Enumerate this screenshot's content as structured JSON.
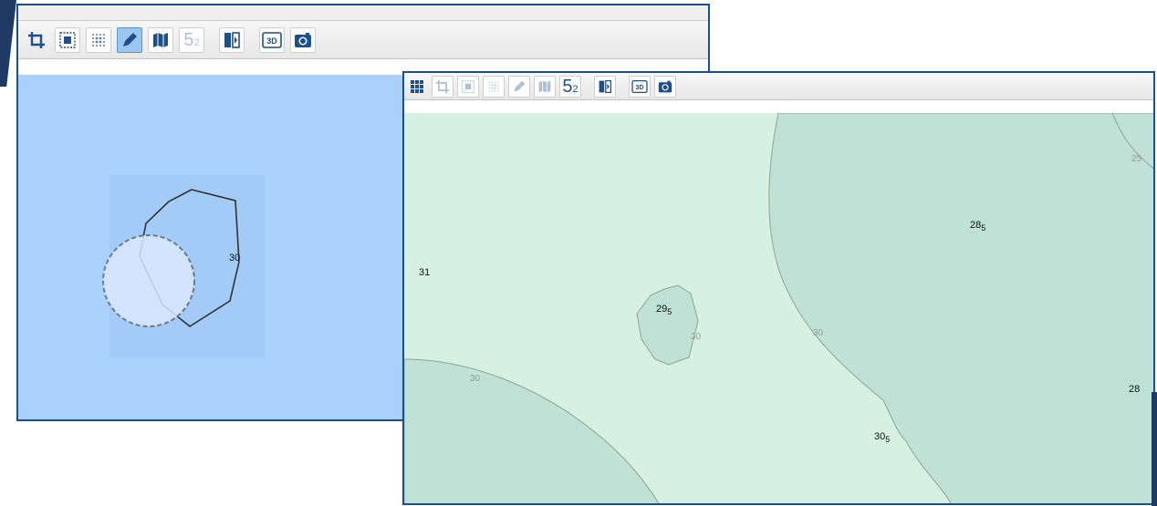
{
  "back_panel": {
    "contour_label": "30",
    "toolbar_icons": [
      "crop-icon",
      "select-frame-icon",
      "dot-grid-icon",
      "pencil-icon",
      "map-icon",
      "subscript-5-2-icon",
      "split-compare-icon",
      "3d-icon",
      "camera-icon"
    ],
    "active_tool": "pencil",
    "subscript_label": {
      "main": "5",
      "sub": "2"
    },
    "three_d_label": "3D"
  },
  "front_panel": {
    "toolbar_icons": [
      "grid-icon",
      "crop-icon",
      "select-frame-icon",
      "dot-grid-icon",
      "pencil-icon",
      "map-icon",
      "subscript-5-2-icon",
      "split-compare-icon",
      "3d-icon",
      "camera-icon"
    ],
    "subscript_label": {
      "main": "5",
      "sub": "2"
    },
    "three_d_label": "3D",
    "labels": {
      "v31": "31",
      "v29_main": "29",
      "v29_sub": "5",
      "v28_5_main": "28",
      "v28_5_sub": "5",
      "v30_5_main": "30",
      "v30_5_sub": "5",
      "v28": "28",
      "v25": "25",
      "iso30": "30"
    }
  },
  "colors": {
    "back_map_bg": "#a9d1fb",
    "front_light_zone": "#d6f0e2",
    "front_dark_zone": "#c0e1d6",
    "accent": "#1f4f8b"
  }
}
